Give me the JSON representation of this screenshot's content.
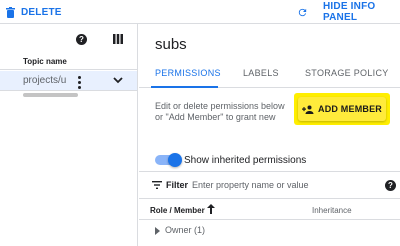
{
  "toolbar": {
    "delete_label": "DELETE",
    "hide_panel_label": "HIDE INFO PANEL"
  },
  "topics": {
    "column_header": "Topic name",
    "rows": [
      "projects/ur"
    ]
  },
  "info_panel": {
    "title": "subs",
    "tabs": [
      {
        "label": "PERMISSIONS",
        "active": true
      },
      {
        "label": "LABELS",
        "active": false
      },
      {
        "label": "STORAGE POLICY",
        "active": false
      }
    ],
    "description": "Edit or delete permissions below or \"Add Member\" to grant new",
    "add_member_label": "ADD MEMBER",
    "show_inherited_label": "Show inherited permissions",
    "show_inherited_on": true,
    "filter": {
      "label": "Filter",
      "placeholder": "Enter property name or value"
    },
    "table": {
      "columns": [
        "Role / Member",
        "Inheritance"
      ],
      "rows": [
        "Owner (1)"
      ]
    }
  },
  "colors": {
    "accent": "#1a73e8",
    "highlight": "#ffee00",
    "selected_row": "#e8f0fe"
  },
  "icons": [
    "delete-icon",
    "refresh-icon",
    "help-icon",
    "columns-icon",
    "more-vert-icon",
    "chevron-down-icon",
    "person-add-icon",
    "filter-icon",
    "sort-arrow-up-icon",
    "expand-caret-icon"
  ]
}
